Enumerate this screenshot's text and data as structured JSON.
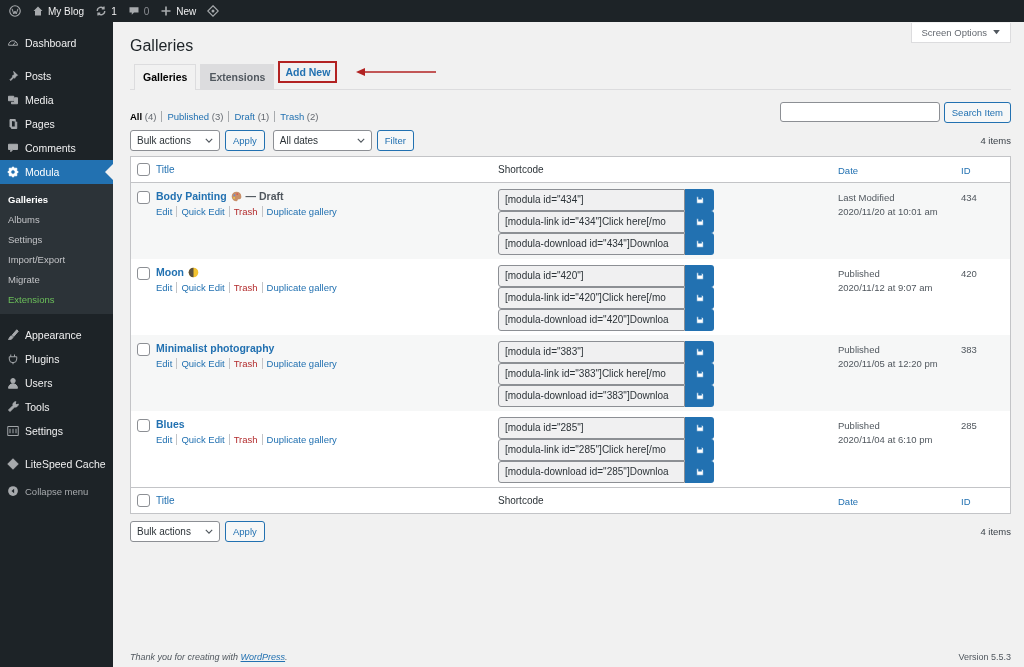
{
  "admin_bar": [
    {
      "kind": "logo"
    },
    {
      "kind": "home",
      "label": "My Blog"
    },
    {
      "kind": "updates",
      "label": "1"
    },
    {
      "kind": "comments",
      "label": "0"
    },
    {
      "kind": "new",
      "label": "New"
    },
    {
      "kind": "diamond"
    }
  ],
  "sidebar": {
    "groups": [
      [
        {
          "label": "Dashboard",
          "selected": false
        }
      ],
      [
        {
          "label": "Posts",
          "selected": false
        },
        {
          "label": "Media",
          "selected": false
        },
        {
          "label": "Pages",
          "selected": false
        },
        {
          "label": "Comments",
          "selected": false
        },
        {
          "label": "Modula",
          "selected": true,
          "submenu": [
            {
              "label": "Galleries",
              "selected": true,
              "accent": false
            },
            {
              "label": "Albums",
              "selected": false,
              "accent": false
            },
            {
              "label": "Settings",
              "selected": false,
              "accent": false
            },
            {
              "label": "Import/Export",
              "selected": false,
              "accent": false
            },
            {
              "label": "Migrate",
              "selected": false,
              "accent": false
            },
            {
              "label": "Extensions",
              "selected": false,
              "accent": true
            }
          ]
        }
      ],
      [
        {
          "label": "Appearance",
          "selected": false
        },
        {
          "label": "Plugins",
          "selected": false
        },
        {
          "label": "Users",
          "selected": false
        },
        {
          "label": "Tools",
          "selected": false
        },
        {
          "label": "Settings",
          "selected": false
        }
      ],
      [
        {
          "label": "LiteSpeed Cache",
          "selected": false
        }
      ]
    ],
    "collapse": "Collapse menu"
  },
  "page": {
    "title": "Galleries",
    "screen_options": "Screen Options",
    "tabs": [
      {
        "label": "Galleries",
        "selected": true,
        "annotated": false
      },
      {
        "label": "Extensions",
        "selected": false,
        "annotated": false
      },
      {
        "label": "Add New",
        "selected": false,
        "annotated": true
      }
    ],
    "views": [
      {
        "label": "All",
        "count": "(4)",
        "selected": true
      },
      {
        "label": "Published",
        "count": "(3)",
        "selected": false
      },
      {
        "label": "Draft",
        "count": "(1)",
        "selected": false
      },
      {
        "label": "Trash",
        "count": "(2)",
        "selected": false
      }
    ],
    "search": {
      "button": "Search Item"
    },
    "top_actions": {
      "bulk": "Bulk actions",
      "apply": "Apply",
      "dates": "All dates",
      "filter": "Filter",
      "count": "4 items"
    },
    "select_all_checked": false,
    "columns": [
      {
        "label": "Title",
        "sortable": true
      },
      {
        "label": "Shortcode",
        "sortable": false
      },
      {
        "label": "Date",
        "sortable": true
      },
      {
        "label": "ID",
        "sortable": true
      }
    ],
    "rows": [
      {
        "kind": "palette",
        "checked": false,
        "title": "Body Painting",
        "state": "— Draft",
        "actions": [
          {
            "label": "Edit",
            "kind": "link"
          },
          {
            "label": "Quick Edit",
            "kind": "link"
          },
          {
            "label": "Trash",
            "kind": "trash"
          },
          {
            "label": "Duplicate gallery",
            "kind": "link"
          }
        ],
        "shortcodes": [
          "[modula id=\"434\"]",
          "[modula-link id=\"434\"]Click here[/mo",
          "[modula-download id=\"434\"]Downloa"
        ],
        "date_status": "Last Modified",
        "date": "2020/11/20 at 10:01 am",
        "id": "434"
      },
      {
        "kind": "moon",
        "checked": false,
        "title": "Moon",
        "actions": [
          {
            "label": "Edit",
            "kind": "link"
          },
          {
            "label": "Quick Edit",
            "kind": "link"
          },
          {
            "label": "Trash",
            "kind": "trash"
          },
          {
            "label": "Duplicate gallery",
            "kind": "link"
          }
        ],
        "shortcodes": [
          "[modula id=\"420\"]",
          "[modula-link id=\"420\"]Click here[/mo",
          "[modula-download id=\"420\"]Downloa"
        ],
        "date_status": "Published",
        "date": "2020/11/12 at 9:07 am",
        "id": "420"
      },
      {
        "kind": "plain",
        "checked": false,
        "title": "Minimalist photography",
        "actions": [
          {
            "label": "Edit",
            "kind": "link"
          },
          {
            "label": "Quick Edit",
            "kind": "link"
          },
          {
            "label": "Trash",
            "kind": "trash"
          },
          {
            "label": "Duplicate gallery",
            "kind": "link"
          }
        ],
        "shortcodes": [
          "[modula id=\"383\"]",
          "[modula-link id=\"383\"]Click here[/mo",
          "[modula-download id=\"383\"]Downloa"
        ],
        "date_status": "Published",
        "date": "2020/11/05 at 12:20 pm",
        "id": "383"
      },
      {
        "kind": "plain",
        "checked": false,
        "title": "Blues",
        "actions": [
          {
            "label": "Edit",
            "kind": "link"
          },
          {
            "label": "Quick Edit",
            "kind": "link"
          },
          {
            "label": "Trash",
            "kind": "trash"
          },
          {
            "label": "Duplicate gallery",
            "kind": "link"
          }
        ],
        "shortcodes": [
          "[modula id=\"285\"]",
          "[modula-link id=\"285\"]Click here[/mo",
          "[modula-download id=\"285\"]Downloa"
        ],
        "date_status": "Published",
        "date": "2020/11/04 at 6:10 pm",
        "id": "285"
      }
    ],
    "footer_select_all_checked": false,
    "footer_columns": [
      {
        "label": "Title",
        "sortable": true
      },
      {
        "label": "Shortcode",
        "sortable": false
      },
      {
        "label": "Date",
        "sortable": true
      },
      {
        "label": "ID",
        "sortable": true
      }
    ],
    "bottom_actions": {
      "bulk": "Bulk actions",
      "apply": "Apply",
      "count": "4 items"
    }
  },
  "footer": {
    "thanks": "Thank you for creating with",
    "link": "WordPress",
    "end": ".",
    "version": "Version 5.5.3"
  }
}
